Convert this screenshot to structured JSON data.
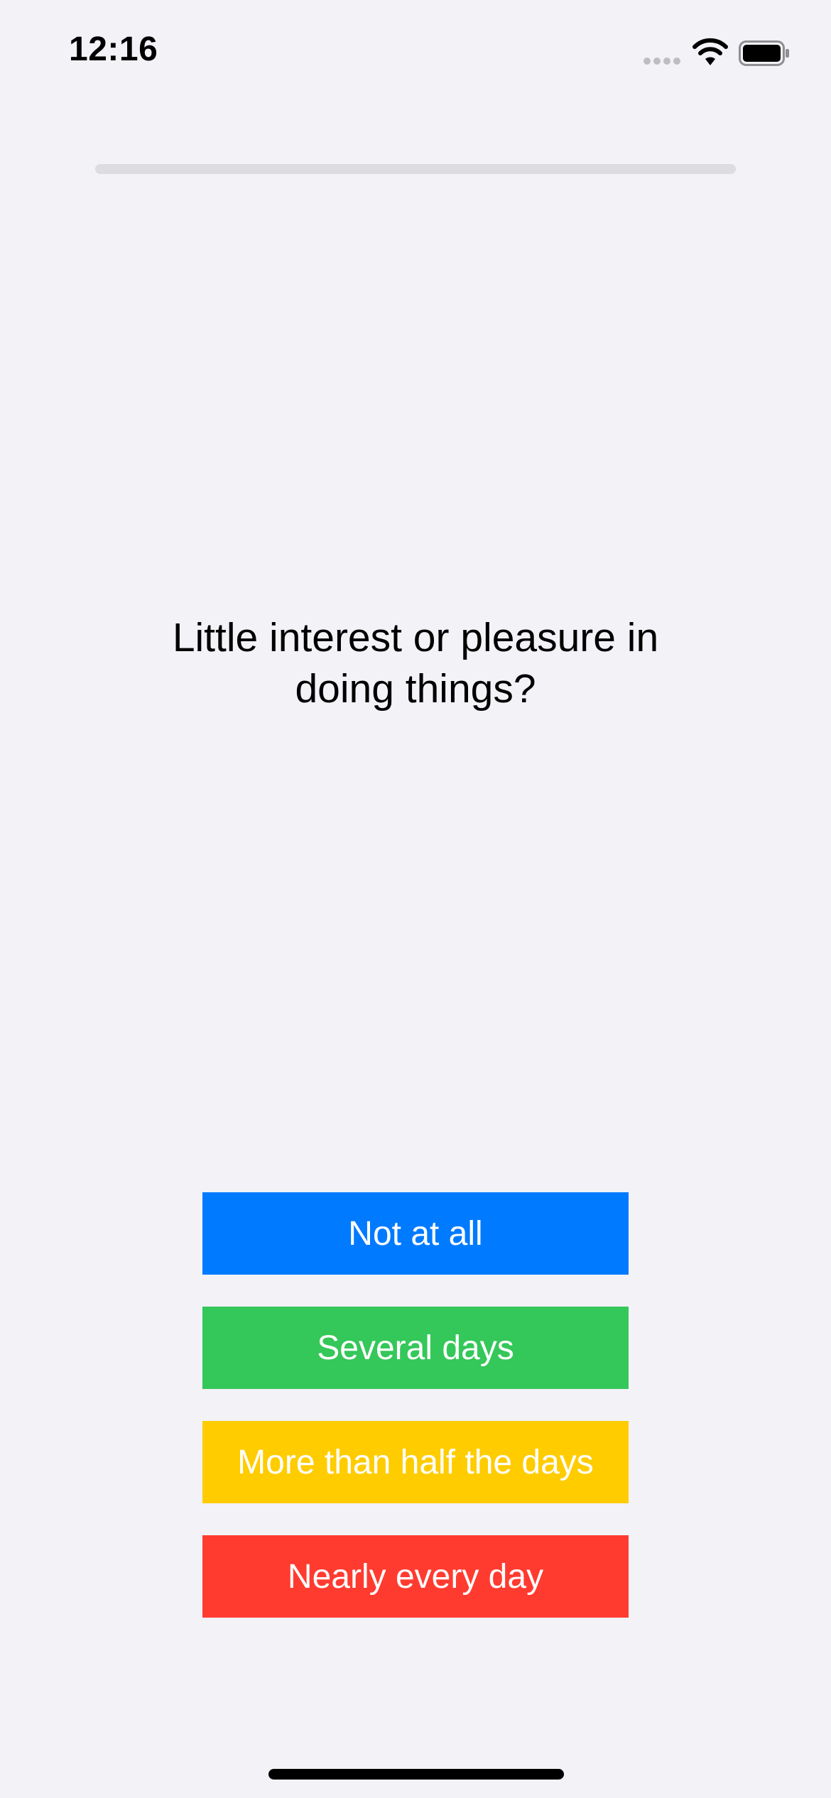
{
  "status_bar": {
    "time": "12:16",
    "icons": [
      "cellular-signal-icon",
      "wifi-icon",
      "battery-icon"
    ]
  },
  "progress": {
    "fraction": 0
  },
  "question": {
    "text": "Little interest or pleasure in doing things?"
  },
  "answers": [
    {
      "label": "Not at all",
      "color": "#007aff"
    },
    {
      "label": "Several days",
      "color": "#34c759"
    },
    {
      "label": "More than half the days",
      "color": "#ffcc00"
    },
    {
      "label": "Nearly every day",
      "color": "#ff3b30"
    }
  ]
}
